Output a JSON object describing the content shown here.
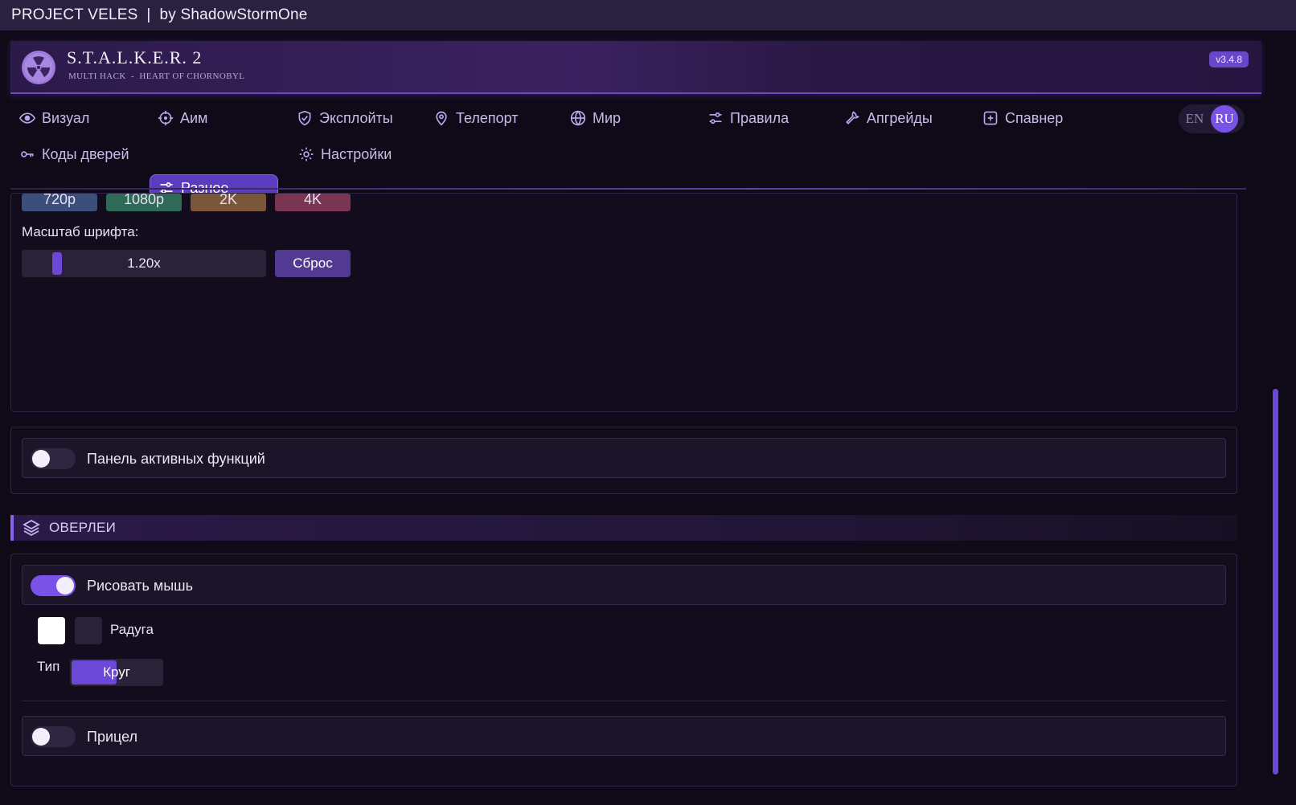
{
  "titlebar": {
    "text": "PROJECT VELES  |  by ShadowStormOne"
  },
  "header": {
    "title": "S.T.A.L.K.E.R. 2",
    "subtitle": "MULTI HACK  -  HEART OF CHORNOBYL",
    "version": "v3.4.8"
  },
  "nav": {
    "tabs": [
      {
        "label": "Визуал",
        "icon": "eye-icon"
      },
      {
        "label": "Аим",
        "icon": "crosshair-icon"
      },
      {
        "label": "Эксплойты",
        "icon": "shield-check-icon"
      },
      {
        "label": "Телепорт",
        "icon": "map-pin-icon"
      },
      {
        "label": "Мир",
        "icon": "globe-icon"
      },
      {
        "label": "Правила",
        "icon": "sliders-icon"
      },
      {
        "label": "Апгрейды",
        "icon": "wrench-icon"
      },
      {
        "label": "Спавнер",
        "icon": "plus-square-icon"
      },
      {
        "label": "Коды дверей",
        "icon": "key-icon"
      },
      {
        "label": "Разное",
        "icon": "sliders-icon",
        "active": true
      },
      {
        "label": "Настройки",
        "icon": "gear-icon"
      }
    ],
    "lang": {
      "en": "EN",
      "ru": "RU",
      "selected": "RU"
    }
  },
  "settings": {
    "resolutions": [
      "720p",
      "1080p",
      "2K",
      "4K"
    ],
    "font_scale_label": "Масштаб шрифта:",
    "font_scale_value": "1.20x",
    "font_scale_fraction": 0.14,
    "reset_label": "Сброс"
  },
  "active_panel": {
    "label": "Панель активных функций",
    "enabled": false
  },
  "overlays": {
    "section_title": "ОВЕРЛЕИ",
    "draw_mouse": {
      "label": "Рисовать мышь",
      "enabled": true
    },
    "rainbow_label": "Радуга",
    "type_label": "Тип",
    "type_value": "Круг",
    "crosshair": {
      "label": "Прицел",
      "enabled": false
    }
  },
  "colors": {
    "accent": "#7a52e8",
    "res_720": "#3a4f7c",
    "res_1080": "#2f6a57",
    "res_2k": "#7a563a",
    "res_4k": "#7a3552"
  }
}
